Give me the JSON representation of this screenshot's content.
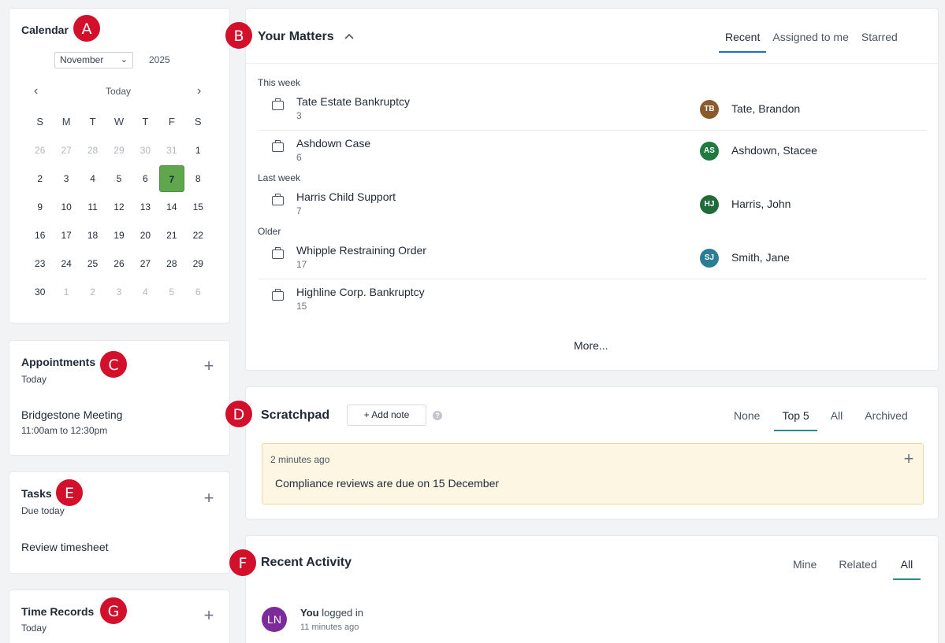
{
  "calendar": {
    "title": "Calendar",
    "badge": "A",
    "month": "November",
    "year": "2025",
    "today_label": "Today",
    "prev_icon": "‹",
    "next_icon": "›",
    "weekdays": [
      "S",
      "M",
      "T",
      "W",
      "T",
      "F",
      "S"
    ],
    "weeks": [
      [
        "26",
        "27",
        "28",
        "29",
        "30",
        "31",
        "1"
      ],
      [
        "2",
        "3",
        "4",
        "5",
        "6",
        "7",
        "8"
      ],
      [
        "9",
        "10",
        "11",
        "12",
        "13",
        "14",
        "15"
      ],
      [
        "16",
        "17",
        "18",
        "19",
        "20",
        "21",
        "22"
      ],
      [
        "23",
        "24",
        "25",
        "26",
        "27",
        "28",
        "29"
      ],
      [
        "30",
        "1",
        "2",
        "3",
        "4",
        "5",
        "6"
      ]
    ],
    "selected_day": "7",
    "today_color": "#5fa64d"
  },
  "appointments": {
    "title": "Appointments",
    "badge": "C",
    "subtitle": "Today",
    "add_icon": "+",
    "items": [
      {
        "title": "Bridgestone Meeting",
        "time": "11:00am to 12:30pm"
      }
    ]
  },
  "tasks": {
    "title": "Tasks",
    "badge": "E",
    "subtitle": "Due today",
    "add_icon": "+",
    "items": [
      {
        "title": "Review timesheet"
      }
    ]
  },
  "time_records": {
    "title": "Time Records",
    "badge": "G",
    "subtitle": "Today",
    "add_icon": "+"
  },
  "matters": {
    "title": "Your Matters",
    "badge": "B",
    "collapse_icon": "chevron-up-icon",
    "tabs": [
      "Recent",
      "Assigned to me",
      "Starred"
    ],
    "active_tab": "Recent",
    "groups": [
      "This week",
      "Last week",
      "Older"
    ],
    "items": [
      {
        "name": "Tate Estate Bankruptcy",
        "number": "3",
        "initials": "TB",
        "person": "Tate, Brandon",
        "avatar_color": "#8b5a2b"
      },
      {
        "name": "Ashdown Case",
        "number": "6",
        "initials": "AS",
        "person": "Ashdown, Stacee",
        "avatar_color": "#1e7a3e"
      },
      {
        "name": "Harris Child Support",
        "number": "7",
        "initials": "HJ",
        "person": "Harris, John",
        "avatar_color": "#1f6b3a"
      },
      {
        "name": "Whipple Restraining Order",
        "number": "17",
        "initials": "SJ",
        "person": "Smith, Jane",
        "avatar_color": "#2a7d94"
      },
      {
        "name": "Highline Corp. Bankruptcy",
        "number": "15",
        "initials": "",
        "person": "",
        "avatar_color": ""
      }
    ],
    "more_label": "More..."
  },
  "scratchpad": {
    "title": "Scratchpad",
    "badge": "D",
    "add_note_label": "+ Add note",
    "help_icon": "?",
    "tabs": [
      "None",
      "Top 5",
      "All",
      "Archived"
    ],
    "active_tab": "Top 5",
    "notes": [
      {
        "time": "2 minutes ago",
        "text": "Compliance reviews are due on 15 December"
      }
    ],
    "note_add_icon": "+"
  },
  "activity": {
    "title": "Recent Activity",
    "badge": "F",
    "tabs": [
      "Mine",
      "Related",
      "All"
    ],
    "active_tab": "All",
    "items": [
      {
        "initials": "LN",
        "actor": "You",
        "action": " logged in",
        "time": "11 minutes ago",
        "avatar_color": "#7b2c9a"
      }
    ]
  },
  "accent": "#1f6fd1",
  "accent_teal": "#2a8a87",
  "badge_color": "#d3102b"
}
